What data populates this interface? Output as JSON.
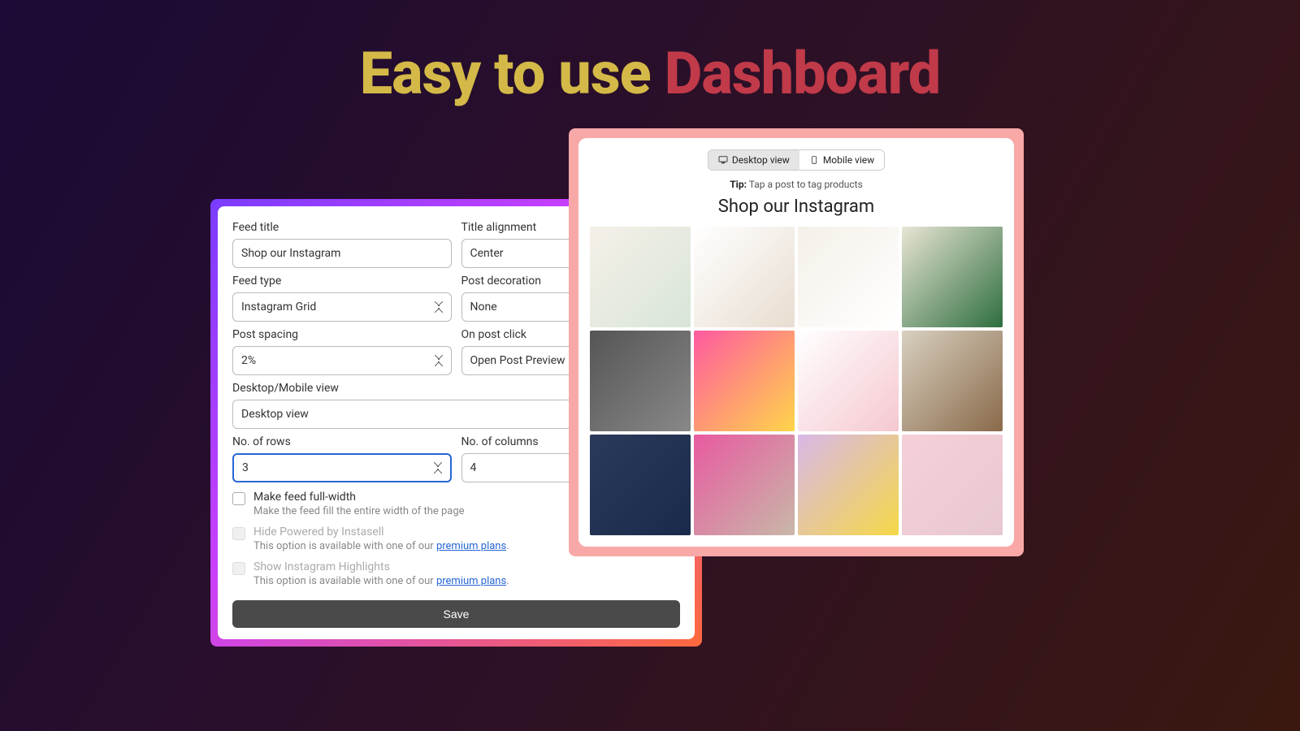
{
  "hero": {
    "part1": "Easy to use ",
    "part2": "Dashboard"
  },
  "settings": {
    "feed_title_label": "Feed title",
    "feed_title_value": "Shop our Instagram",
    "title_alignment_label": "Title alignment",
    "title_alignment_value": "Center",
    "feed_type_label": "Feed type",
    "feed_type_value": "Instagram Grid",
    "post_decoration_label": "Post decoration",
    "post_decoration_value": "None",
    "post_spacing_label": "Post spacing",
    "post_spacing_value": "2%",
    "on_post_click_label": "On post click",
    "on_post_click_value": "Open Post Preview",
    "view_label": "Desktop/Mobile view",
    "view_value": "Desktop view",
    "rows_label": "No. of rows",
    "rows_value": "3",
    "cols_label": "No. of columns",
    "cols_value": "4",
    "full_width_label": "Make feed full-width",
    "full_width_desc": "Make the feed fill the entire width of the page",
    "hide_powered_label": "Hide Powered by Instasell",
    "premium_desc_prefix": "This option is available with one of our ",
    "premium_link": "premium plans",
    "premium_desc_suffix": ".",
    "highlights_label": "Show Instagram Highlights",
    "save_label": "Save"
  },
  "preview": {
    "desktop_label": "Desktop view",
    "mobile_label": "Mobile view",
    "tip_bold": "Tip:",
    "tip_text": " Tap a post to tag products",
    "feed_heading": "Shop our Instagram"
  }
}
